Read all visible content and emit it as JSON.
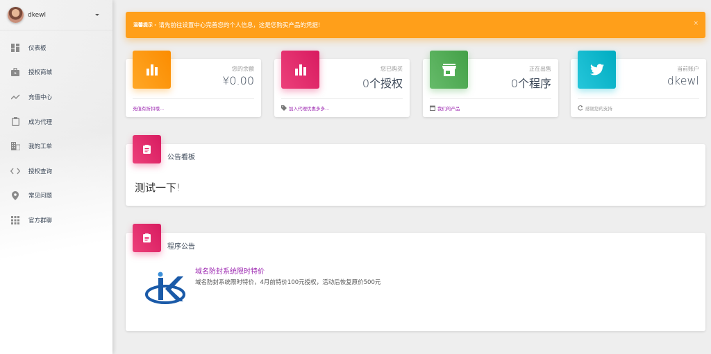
{
  "user": {
    "name": "dkewl"
  },
  "sidebar": {
    "items": [
      {
        "label": "仪表板",
        "icon": "dashboard-icon"
      },
      {
        "label": "授权商城",
        "icon": "shop-bag-icon"
      },
      {
        "label": "充值中心",
        "icon": "trending-icon"
      },
      {
        "label": "成为代理",
        "icon": "clipboard-icon"
      },
      {
        "label": "我的工单",
        "icon": "building-icon"
      },
      {
        "label": "授权查询",
        "icon": "code-icon"
      },
      {
        "label": "常见问题",
        "icon": "location-pin-icon"
      },
      {
        "label": "官方群聊",
        "icon": "apps-grid-icon"
      }
    ]
  },
  "alert": {
    "strong": "温馨提示 -",
    "text": "请先前往设置中心完善您的个人信息，这是您购买产品的凭据!",
    "close": "×"
  },
  "stats": [
    {
      "title": "您的余额",
      "value": "¥0.00",
      "footer": "充值有折扣哦...",
      "icon": "bar-chart-icon",
      "color": "#ff9800",
      "footer_color": "#9c27b0"
    },
    {
      "title": "您已购买",
      "value": "0个授权",
      "footer": "加入代理优惠多多...",
      "icon": "bar-chart-icon",
      "color": "#e91e63",
      "footer_color": "#9c27b0"
    },
    {
      "title": "正在出售",
      "value": "0个程序",
      "footer": "我们的产品",
      "icon": "store-icon",
      "color": "#4caf50",
      "footer_color": "#9c27b0"
    },
    {
      "title": "当前账户",
      "value": "dkewl",
      "footer": "感谢您的支持",
      "icon": "twitter-bird-icon",
      "color": "#00bcd4",
      "footer_color": "#999999"
    }
  ],
  "notice": {
    "title": "公告看板",
    "body": "测试一下!"
  },
  "program": {
    "title": "程序公告",
    "item_title": "域名防封系统限时特价",
    "item_desc": "域名防封系统限时特价，4月前特价100元授权，活动后恢复原价500元"
  }
}
